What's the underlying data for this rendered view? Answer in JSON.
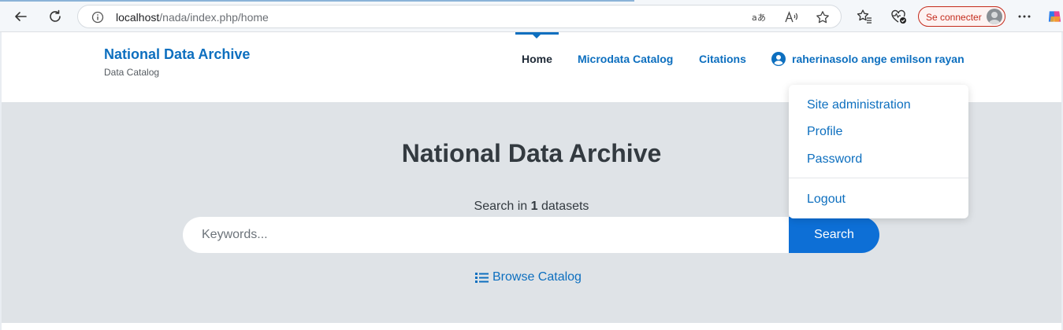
{
  "browser": {
    "url_host": "localhost",
    "url_path": "/nada/index.php/home",
    "signin_label": "Se connecter"
  },
  "site": {
    "brand_title": "National Data Archive",
    "brand_subtitle": "Data Catalog"
  },
  "nav": {
    "home": "Home",
    "microdata": "Microdata Catalog",
    "citations": "Citations",
    "user_name": "raherinasolo ange emilson rayan"
  },
  "user_menu": {
    "items": [
      "Site administration",
      "Profile",
      "Password"
    ],
    "logout": "Logout"
  },
  "hero": {
    "title": "National Data Archive",
    "search_prefix": "Search in ",
    "dataset_count": "1",
    "search_suffix": " datasets",
    "search_placeholder": "Keywords...",
    "search_button": "Search",
    "browse_label": "Browse Catalog"
  },
  "colors": {
    "accent": "#0d6fbf",
    "button": "#0d6fd6",
    "hero_bg": "#dfe3e7"
  }
}
